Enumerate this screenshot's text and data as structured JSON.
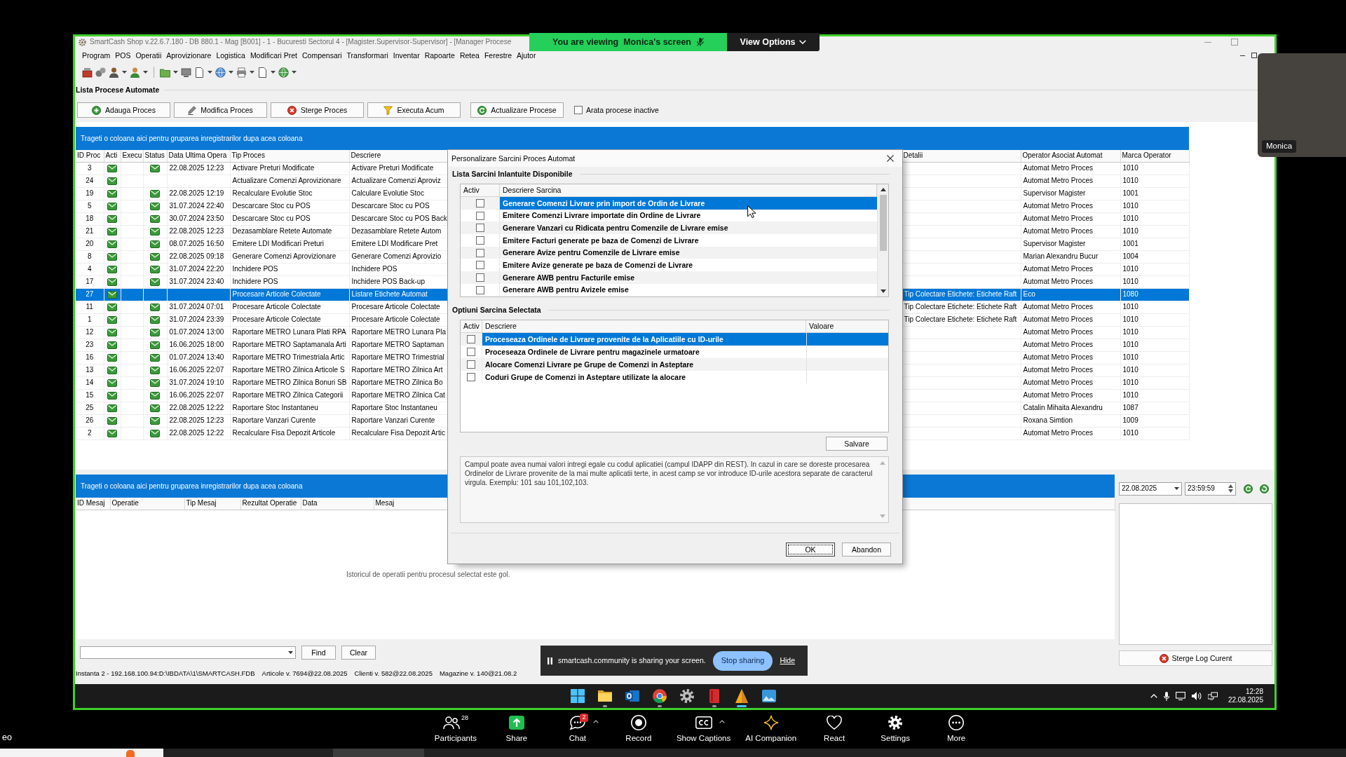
{
  "meeting_banner": {
    "message": "You are viewing  Monica's screen",
    "menu": "View Options"
  },
  "video_tile": {
    "name": "Monica"
  },
  "app": {
    "title": "SmartCash Shop v.22.6.7.180 - DB 880.1 - Mag [B001] - 1 - Bucuresti Sectorul 4 - [Magister.Supervisor-Supervisor] - [Manager Procese",
    "menu": [
      "Program",
      "POS",
      "Operatii",
      "Aprovizionare",
      "Logistica",
      "Modificari Pret",
      "Compensari",
      "Transformari",
      "Inventar",
      "Rapoarte",
      "Retea",
      "Ferestre",
      "Ajutor"
    ],
    "section_title": "Lista Procese Automate",
    "actions": [
      {
        "kind": "add",
        "label": "Adauga Proces"
      },
      {
        "kind": "edit",
        "label": "Modifica Proces"
      },
      {
        "kind": "delete",
        "label": "Sterge Proces"
      },
      {
        "kind": "run",
        "label": "Executa Acum"
      },
      {
        "kind": "refresh",
        "label": "Actualizare Procese"
      }
    ],
    "show_inactive": {
      "label": "Arata procese inactive",
      "checked": false
    },
    "process_grid": {
      "group_hint": "Trageti o coloana aici pentru gruparea inregistrarilor dupa acea coloana",
      "columns": [
        "ID Proc",
        "Acti",
        "Execu",
        "Status",
        "Data Ultima Opera",
        "Tip Proces",
        "Descriere",
        "Detalii",
        "Operator Asociat Automat",
        "Marca Operator"
      ],
      "rows": [
        {
          "id": "3",
          "active": true,
          "status": true,
          "date": "22.08.2025 12:23",
          "type": "Activare Preturi Modificate",
          "description": "Activare Preturi Modificate",
          "operator": "Automat Metro Proces",
          "code": "1010",
          "selected": false
        },
        {
          "id": "24",
          "active": true,
          "status": false,
          "type": "Actualizare Comenzi Aprovizionare",
          "description": "Actualizare Comenzi Aproviz",
          "operator": "Automat Metro Proces",
          "code": "1010",
          "selected": false
        },
        {
          "id": "19",
          "active": true,
          "status": true,
          "date": "22.08.2025 12:19",
          "type": "Recalculare Evolutie Stoc",
          "description": "Calculare Evolutie Stoc",
          "operator": "Supervisor Magister",
          "code": "1001",
          "selected": false
        },
        {
          "id": "5",
          "active": true,
          "status": true,
          "date": "31.07.2024 22:40",
          "type": "Descarcare Stoc cu POS",
          "description": "Descarcare Stoc cu POS",
          "operator": "Automat Metro Proces",
          "code": "1010",
          "selected": false
        },
        {
          "id": "18",
          "active": true,
          "status": true,
          "date": "30.07.2024 23:50",
          "type": "Descarcare Stoc cu POS",
          "description": "Descarcare Stoc cu POS Back",
          "operator": "Automat Metro Proces",
          "code": "1010",
          "selected": false
        },
        {
          "id": "21",
          "active": true,
          "status": true,
          "date": "22.08.2025 12:23",
          "type": "Dezasamblare Retete Automate",
          "description": "Dezasamblare Retete Autom",
          "operator": "Automat Metro Proces",
          "code": "1010",
          "selected": false
        },
        {
          "id": "20",
          "active": true,
          "status": true,
          "date": "08.07.2025 16:50",
          "type": "Emitere LDI Modificari Preturi",
          "description": "Emitere LDI Modificare Pret",
          "operator": "Supervisor Magister",
          "code": "1001",
          "selected": false
        },
        {
          "id": "8",
          "active": true,
          "status": true,
          "date": "22.08.2025 09:18",
          "type": "Generare Comenzi Aprovizionare",
          "description": "Generare Comenzi Aprovizio",
          "operator": "Marian Alexandru Bucur",
          "code": "1004",
          "selected": false
        },
        {
          "id": "4",
          "active": true,
          "status": true,
          "date": "31.07.2024 22:20",
          "type": "Inchidere POS",
          "description": "Inchidere POS",
          "operator": "Automat Metro Proces",
          "code": "1010",
          "selected": false
        },
        {
          "id": "17",
          "active": true,
          "status": true,
          "date": "31.07.2024 23:40",
          "type": "Inchidere POS",
          "description": "Inchidere POS Back-up",
          "operator": "Automat Metro Proces",
          "code": "1010",
          "selected": false
        },
        {
          "id": "27",
          "active": true,
          "status": false,
          "type": "Procesare Articole Colectate",
          "description": "Listare Etichete Automat",
          "details": "Tip Colectare Etichete: Etichete Raft",
          "operator": "Eco",
          "code": "1080",
          "selected": true
        },
        {
          "id": "11",
          "active": true,
          "status": true,
          "date": "31.07.2024 07:01",
          "type": "Procesare Articole Colectate",
          "description": "Procesare Articole Colectate",
          "details": "Tip Colectare Etichete: Etichete Raft",
          "operator": "Automat Metro Proces",
          "code": "1010",
          "selected": false
        },
        {
          "id": "1",
          "active": true,
          "status": true,
          "date": "31.07.2024 23:39",
          "type": "Procesare Articole Colectate",
          "description": "Procesare Articole Colectate",
          "details": "Tip Colectare Etichete: Etichete Raft",
          "operator": "Automat Metro Proces",
          "code": "1010",
          "selected": false
        },
        {
          "id": "12",
          "active": true,
          "status": true,
          "date": "01.07.2024 13:00",
          "type": "Raportare METRO Lunara Plati RPA",
          "description": "Raportare METRO Lunara Pla",
          "operator": "Automat Metro Proces",
          "code": "1010",
          "selected": false
        },
        {
          "id": "23",
          "active": true,
          "status": true,
          "date": "16.06.2025 18:00",
          "type": "Raportare METRO Saptamanala Arti",
          "description": "Raportare METRO Saptaman",
          "operator": "Automat Metro Proces",
          "code": "1010",
          "selected": false
        },
        {
          "id": "16",
          "active": true,
          "status": true,
          "date": "01.07.2024 13:40",
          "type": "Raportare METRO Trimestriala Artic",
          "description": "Raportare METRO Trimestrial",
          "operator": "Automat Metro Proces",
          "code": "1010",
          "selected": false
        },
        {
          "id": "13",
          "active": true,
          "status": true,
          "date": "16.06.2025 22:07",
          "type": "Raportare METRO Zilnica Articole S",
          "description": "Raportare METRO Zilnica Art",
          "operator": "Automat Metro Proces",
          "code": "1010",
          "selected": false
        },
        {
          "id": "14",
          "active": true,
          "status": true,
          "date": "31.07.2024 19:10",
          "type": "Raportare METRO Zilnica Bonuri SB",
          "description": "Raportare METRO Zilnica Bo",
          "operator": "Automat Metro Proces",
          "code": "1010",
          "selected": false
        },
        {
          "id": "15",
          "active": true,
          "status": true,
          "date": "16.06.2025 22:07",
          "type": "Raportare METRO Zilnica Categorii",
          "description": "Raportare METRO Zilnica Cat",
          "operator": "Automat Metro Proces",
          "code": "1010",
          "selected": false
        },
        {
          "id": "25",
          "active": true,
          "status": true,
          "date": "22.08.2025 12:22",
          "type": "Raportare Stoc Instantaneu",
          "description": "Raportare Stoc Instantaneu",
          "operator": "Catalin Mihaita Alexandru",
          "code": "1087",
          "selected": false
        },
        {
          "id": "26",
          "active": true,
          "status": true,
          "date": "22.08.2025 12:23",
          "type": "Raportare Vanzari Curente",
          "description": "Raportare Vanzari Curente",
          "operator": "Roxana  Simtion",
          "code": "1009",
          "selected": false
        },
        {
          "id": "2",
          "active": true,
          "status": true,
          "date": "22.08.2025 12:22",
          "type": "Recalculare Fisa Depozit Articole",
          "description": "Recalculare Fisa Depozit Artic",
          "operator": "Automat Metro Proces",
          "code": "1010",
          "selected": false
        }
      ]
    },
    "log_grid": {
      "group_hint": "Trageti o coloana aici pentru gruparea inregistrarilor dupa acea coloana",
      "columns": [
        "ID Mesaj",
        "Operatie",
        "Tip Mesaj",
        "Rezultat Operatie",
        "Data",
        "Mesaj"
      ],
      "empty_text": "Istoricul de operatii pentru procesul selectat este gol."
    },
    "search": {
      "find": "Find",
      "clear": "Clear"
    },
    "log_panel": {
      "date": "22.08.2025",
      "time": "23:59:59",
      "clear_button": "Sterge Log Curent"
    },
    "status_bar": [
      "Instanta 2 - 192.168.100.94:D:\\IBDATA\\1\\SMARTCASH.FDB",
      "Articole v. 7694@22.08.2025",
      "Clienti v. 582@22.08.2025",
      "Magazine v. 140@21.08.2"
    ]
  },
  "dialog": {
    "title": "Personalizare Sarcini Proces Automat",
    "tasks_group": "Lista Sarcini Inlantuite Disponibile",
    "tasks": {
      "columns": [
        "Activ",
        "Descriere Sarcina"
      ],
      "rows": [
        {
          "text": "Generare Comenzi Livrare prin import de Ordin de Livrare",
          "checked": false,
          "selected": true
        },
        {
          "text": "Emitere Comenzi Livrare importate din Ordine de Livrare",
          "checked": false,
          "selected": false
        },
        {
          "text": "Generare Vanzari cu Ridicata pentru Comenzile de Livrare emise",
          "checked": false,
          "selected": false
        },
        {
          "text": "Emitere Facturi generate pe baza de Comenzi de Livrare",
          "checked": false,
          "selected": false
        },
        {
          "text": "Generare Avize pentru Comenzile de Livrare emise",
          "checked": false,
          "selected": false
        },
        {
          "text": "Emitere Avize generate pe baza de Comenzi de Livrare",
          "checked": false,
          "selected": false
        },
        {
          "text": "Generare AWB pentru Facturile emise",
          "checked": false,
          "selected": false
        },
        {
          "text": "Generare AWB pentru Avizele emise",
          "checked": false,
          "selected": false
        }
      ]
    },
    "options_group": "Optiuni Sarcina Selectata",
    "options": {
      "columns": [
        "Activ",
        "Descriere",
        "Valoare"
      ],
      "rows": [
        {
          "text": "Proceseaza Ordinele de Livrare provenite de la Aplicatiile cu ID-urile",
          "checked": false,
          "selected": true
        },
        {
          "text": "Proceseaza Ordinele de Livrare pentru magazinele urmatoare",
          "checked": false,
          "selected": false
        },
        {
          "text": "Alocare Comenzi Livrare pe Grupe de Comenzi in Asteptare",
          "checked": false,
          "selected": false
        },
        {
          "text": "Coduri Grupe de Comenzi in Asteptare utilizate la alocare",
          "checked": false,
          "selected": false
        }
      ]
    },
    "save_button": "Salvare",
    "help_text": "Campul poate avea numai valori intregi egale cu codul aplicatiei (campul IDAPP din REST). In cazul in care se doreste procesarea Ordinelor de Livrare provenite de la mai multe aplicatii terte, in acest camp se vor introduce ID-urile acestora separate de caracterul virgula. Exemplu: 101 sau 101,102,103.",
    "buttons": [
      {
        "label": "OK",
        "focused": true
      },
      {
        "label": "Abandon",
        "focused": false
      }
    ]
  },
  "sharing_bar": {
    "message": "smartcash.community is sharing your screen.",
    "stop": "Stop sharing",
    "hide": "Hide"
  },
  "taskbar": {
    "apps": [
      {
        "kind": "start",
        "running": false,
        "active": false
      },
      {
        "kind": "explorer",
        "running": true,
        "active": false
      },
      {
        "kind": "mail",
        "running": false,
        "active": false
      },
      {
        "kind": "browser",
        "running": true,
        "active": false
      },
      {
        "kind": "settings",
        "running": false,
        "active": false
      },
      {
        "kind": "reader",
        "running": true,
        "active": false
      },
      {
        "kind": "cone",
        "running": true,
        "active": true
      },
      {
        "kind": "photos",
        "running": false,
        "active": false
      }
    ],
    "time": "12:28",
    "date": "22.08.2025"
  },
  "meeting_toolbar": {
    "cut_label": "eo",
    "items": [
      {
        "kind": "participants",
        "label": "Participants",
        "count": "28",
        "menu": false
      },
      {
        "kind": "share",
        "label": "Share",
        "menu": false
      },
      {
        "kind": "chat",
        "label": "Chat",
        "badge": "2",
        "menu": true
      },
      {
        "kind": "record",
        "label": "Record",
        "menu": false
      },
      {
        "kind": "captions",
        "label": "Show Captions",
        "menu": true
      },
      {
        "kind": "ai",
        "label": "AI Companion",
        "menu": false
      },
      {
        "kind": "react",
        "label": "React",
        "menu": false
      },
      {
        "kind": "settings",
        "label": "Settings",
        "menu": false
      },
      {
        "kind": "more",
        "label": "More",
        "menu": false
      }
    ]
  }
}
